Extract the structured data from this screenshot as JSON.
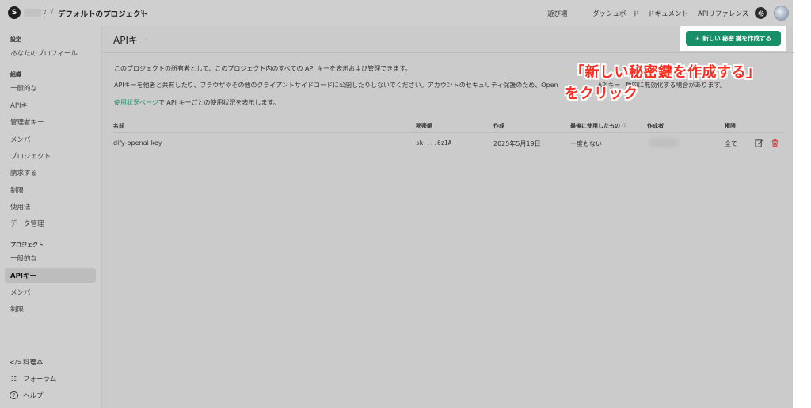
{
  "topbar": {
    "org_initial": "S",
    "project_name": "デフォルトのプロジェクト",
    "nav": [
      "遊び場",
      "ダッシュボード",
      "ドキュメント",
      "APIリファレンス"
    ]
  },
  "sidebar": {
    "settings_title": "設定",
    "profile": "あなたのプロフィール",
    "org_title": "組織",
    "org_items": [
      "一般的な",
      "APIキー",
      "管理者キー",
      "メンバー",
      "プロジェクト",
      "請求する",
      "制限",
      "使用法",
      "データ管理"
    ],
    "project_title": "プロジェクト",
    "project_items": [
      "一般的な",
      "APIキー",
      "メンバー",
      "制限"
    ],
    "footer": [
      {
        "icon": "</>",
        "label": "料理本"
      },
      {
        "icon": "☷",
        "label": "フォーラム"
      },
      {
        "icon": "?",
        "label": "ヘルプ"
      }
    ]
  },
  "main": {
    "title": "APIキー",
    "create_button": "新しい 秘密 鍵を作成する",
    "desc1": "このプロジェクトの所有者として、このプロジェクト内のすべての API キーを表示および管理できます。",
    "desc2": "APIキーを他者と共有したり、ブラウザやその他のクライアントサイドコードに公開したりしないでください。アカウントのセキュリティ保護のため、Open",
    "desc2_tail": "APIキー",
    "desc2_end": "動的に無効化する場合があります。",
    "usage_link": "使用状況ページ",
    "usage_text": "で API キーごとの使用状況を表示します。",
    "columns": [
      "名前",
      "秘密鍵",
      "作成",
      "最後に使用したもの",
      "作成者",
      "権限"
    ],
    "rows": [
      {
        "name": "dify-openai-key",
        "secret": "sk-...6zIA",
        "created": "2025年5月19日",
        "last_used": "一度もない",
        "permission": "全て"
      }
    ]
  },
  "annotation": {
    "line1": "「新しい秘密鍵を作成する」",
    "line2": "をクリック"
  },
  "colors": {
    "accent": "#178f68",
    "annotation": "#ff2d1f",
    "delete": "#d9342b"
  }
}
